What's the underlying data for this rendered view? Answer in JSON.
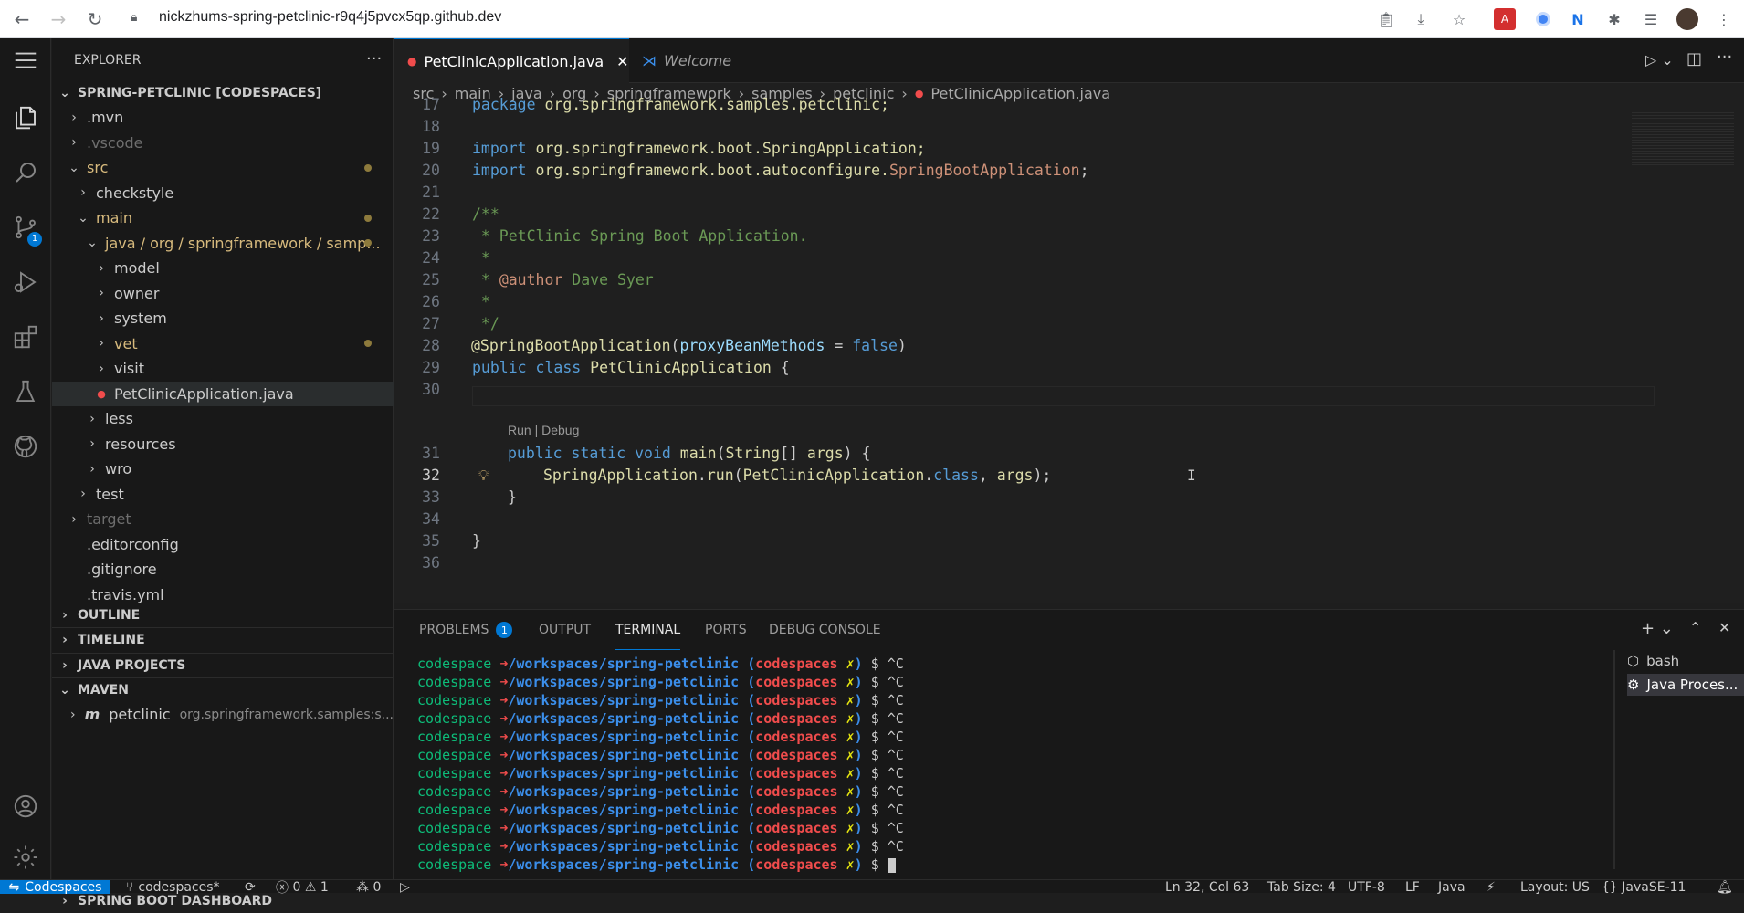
{
  "browser": {
    "url": "nickzhums-spring-petclinic-r9q4j5pvcx5qp.github.dev"
  },
  "sidebar": {
    "title": "EXPLORER",
    "root": "SPRING-PETCLINIC [CODESPACES]",
    "tree": [
      {
        "label": ".mvn",
        "indent": 1,
        "chev": "›",
        "color": "#cccccc"
      },
      {
        "label": ".vscode",
        "indent": 1,
        "chev": "›",
        "color": "#6e6e6e"
      },
      {
        "label": "src",
        "indent": 1,
        "chev": "⌄",
        "color": "#d7ba7d",
        "dot": true
      },
      {
        "label": "checkstyle",
        "indent": 2,
        "chev": "›",
        "color": "#cccccc"
      },
      {
        "label": "main",
        "indent": 2,
        "chev": "⌄",
        "color": "#d7ba7d",
        "dot": true
      },
      {
        "label": "java / org / springframework / samp...",
        "indent": 3,
        "chev": "⌄",
        "color": "#d7ba7d",
        "dot": true
      },
      {
        "label": "model",
        "indent": 4,
        "chev": "›",
        "color": "#cccccc"
      },
      {
        "label": "owner",
        "indent": 4,
        "chev": "›",
        "color": "#cccccc"
      },
      {
        "label": "system",
        "indent": 4,
        "chev": "›",
        "color": "#cccccc"
      },
      {
        "label": "vet",
        "indent": 4,
        "chev": "›",
        "color": "#d7ba7d",
        "dot": true
      },
      {
        "label": "visit",
        "indent": 4,
        "chev": "›",
        "color": "#cccccc"
      },
      {
        "label": "PetClinicApplication.java",
        "indent": 4,
        "chev": "",
        "color": "#cccccc",
        "selected": true
      },
      {
        "label": "less",
        "indent": 3,
        "chev": "›",
        "color": "#cccccc"
      },
      {
        "label": "resources",
        "indent": 3,
        "chev": "›",
        "color": "#cccccc"
      },
      {
        "label": "wro",
        "indent": 3,
        "chev": "›",
        "color": "#cccccc"
      },
      {
        "label": "test",
        "indent": 2,
        "chev": "›",
        "color": "#cccccc"
      },
      {
        "label": "target",
        "indent": 1,
        "chev": "›",
        "color": "#6e6e6e"
      },
      {
        "label": ".editorconfig",
        "indent": 1,
        "chev": "",
        "color": "#cccccc"
      },
      {
        "label": ".gitignore",
        "indent": 1,
        "chev": "",
        "color": "#cccccc"
      },
      {
        "label": ".travis.yml",
        "indent": 1,
        "chev": "",
        "color": "#cccccc"
      }
    ],
    "sections": {
      "outline": "OUTLINE",
      "timeline": "TIMELINE",
      "java_projects": "JAVA PROJECTS",
      "maven": "MAVEN",
      "maven_item": "petclinic",
      "maven_item_desc": "org.springframework.samples:s...",
      "spring_boot": "SPRING BOOT DASHBOARD"
    },
    "scm_badge": "1"
  },
  "editor": {
    "tabs": [
      {
        "label": "PetClinicApplication.java",
        "active": true
      },
      {
        "label": "Welcome",
        "active": false
      }
    ],
    "breadcrumb": [
      "src",
      "main",
      "java",
      "org",
      "springframework",
      "samples",
      "petclinic",
      "PetClinicApplication.java"
    ],
    "line_numbers": [
      "17",
      "18",
      "19",
      "20",
      "21",
      "22",
      "23",
      "24",
      "25",
      "26",
      "27",
      "28",
      "29",
      "30",
      "31",
      "32",
      "33",
      "34",
      "35",
      "36"
    ],
    "code": {
      "l17a": "package",
      "l17b": " org.springframework.samples.petclinic;",
      "l19a": "import",
      "l19b": " org.springframework.boot.SpringApplication;",
      "l20a": "import",
      "l20b": " org.springframework.boot.autoconfigure.",
      "l20c": "SpringBootApplication",
      "l20d": ";",
      "l22": "/**",
      "l23": " * PetClinic Spring Boot Application.",
      "l24": " *",
      "l25a": " * ",
      "l25b": "@author",
      "l25c": " Dave Syer",
      "l26": " *",
      "l27": " */",
      "l28a": "@SpringBootApplication",
      "l28b": "(",
      "l28c": "proxyBeanMethods",
      "l28d": " = ",
      "l28e": "false",
      "l28f": ")",
      "l29a": "public",
      "l29b": " ",
      "l29c": "class",
      "l29d": " ",
      "l29e": "PetClinicApplication",
      "l29f": " {",
      "codelens": "Run | Debug",
      "l31a": "public",
      "l31b": " ",
      "l31c": "static",
      "l31d": " ",
      "l31e": "void",
      "l31f": " ",
      "l31g": "main",
      "l31h": "(",
      "l31i": "String",
      "l31j": "[] ",
      "l31k": "args",
      "l31l": ") {",
      "l32a": "SpringApplication",
      "l32b": ".",
      "l32c": "run",
      "l32d": "(",
      "l32e": "PetClinicApplication",
      "l32f": ".",
      "l32g": "class",
      "l32h": ", ",
      "l32i": "args",
      "l32j": ");",
      "l33": "}",
      "l35": "}"
    }
  },
  "panel": {
    "tabs": [
      "PROBLEMS",
      "OUTPUT",
      "TERMINAL",
      "PORTS",
      "DEBUG CONSOLE"
    ],
    "problems_count": "1",
    "terminal_prompt": {
      "user": "codespace ",
      "arrow": "➜",
      "path": "/workspaces/spring-petclinic ",
      "br_open": "(",
      "branch": "codespaces",
      "x": " ✗",
      "br_close": ")",
      "prompt": " $ ",
      "cmd": "^C"
    },
    "terminal_lines_count": 12,
    "terminals": [
      "bash",
      "Java Proces..."
    ]
  },
  "status": {
    "remote": "Codespaces",
    "branch": "codespaces*",
    "errors": "0",
    "warnings": "1",
    "ports": "0",
    "position": "Ln 32, Col 63",
    "tab_size": "Tab Size: 4",
    "encoding": "UTF-8",
    "eol": "LF",
    "language": "Java",
    "layout": "Layout: US",
    "jdk": "JavaSE-11"
  }
}
